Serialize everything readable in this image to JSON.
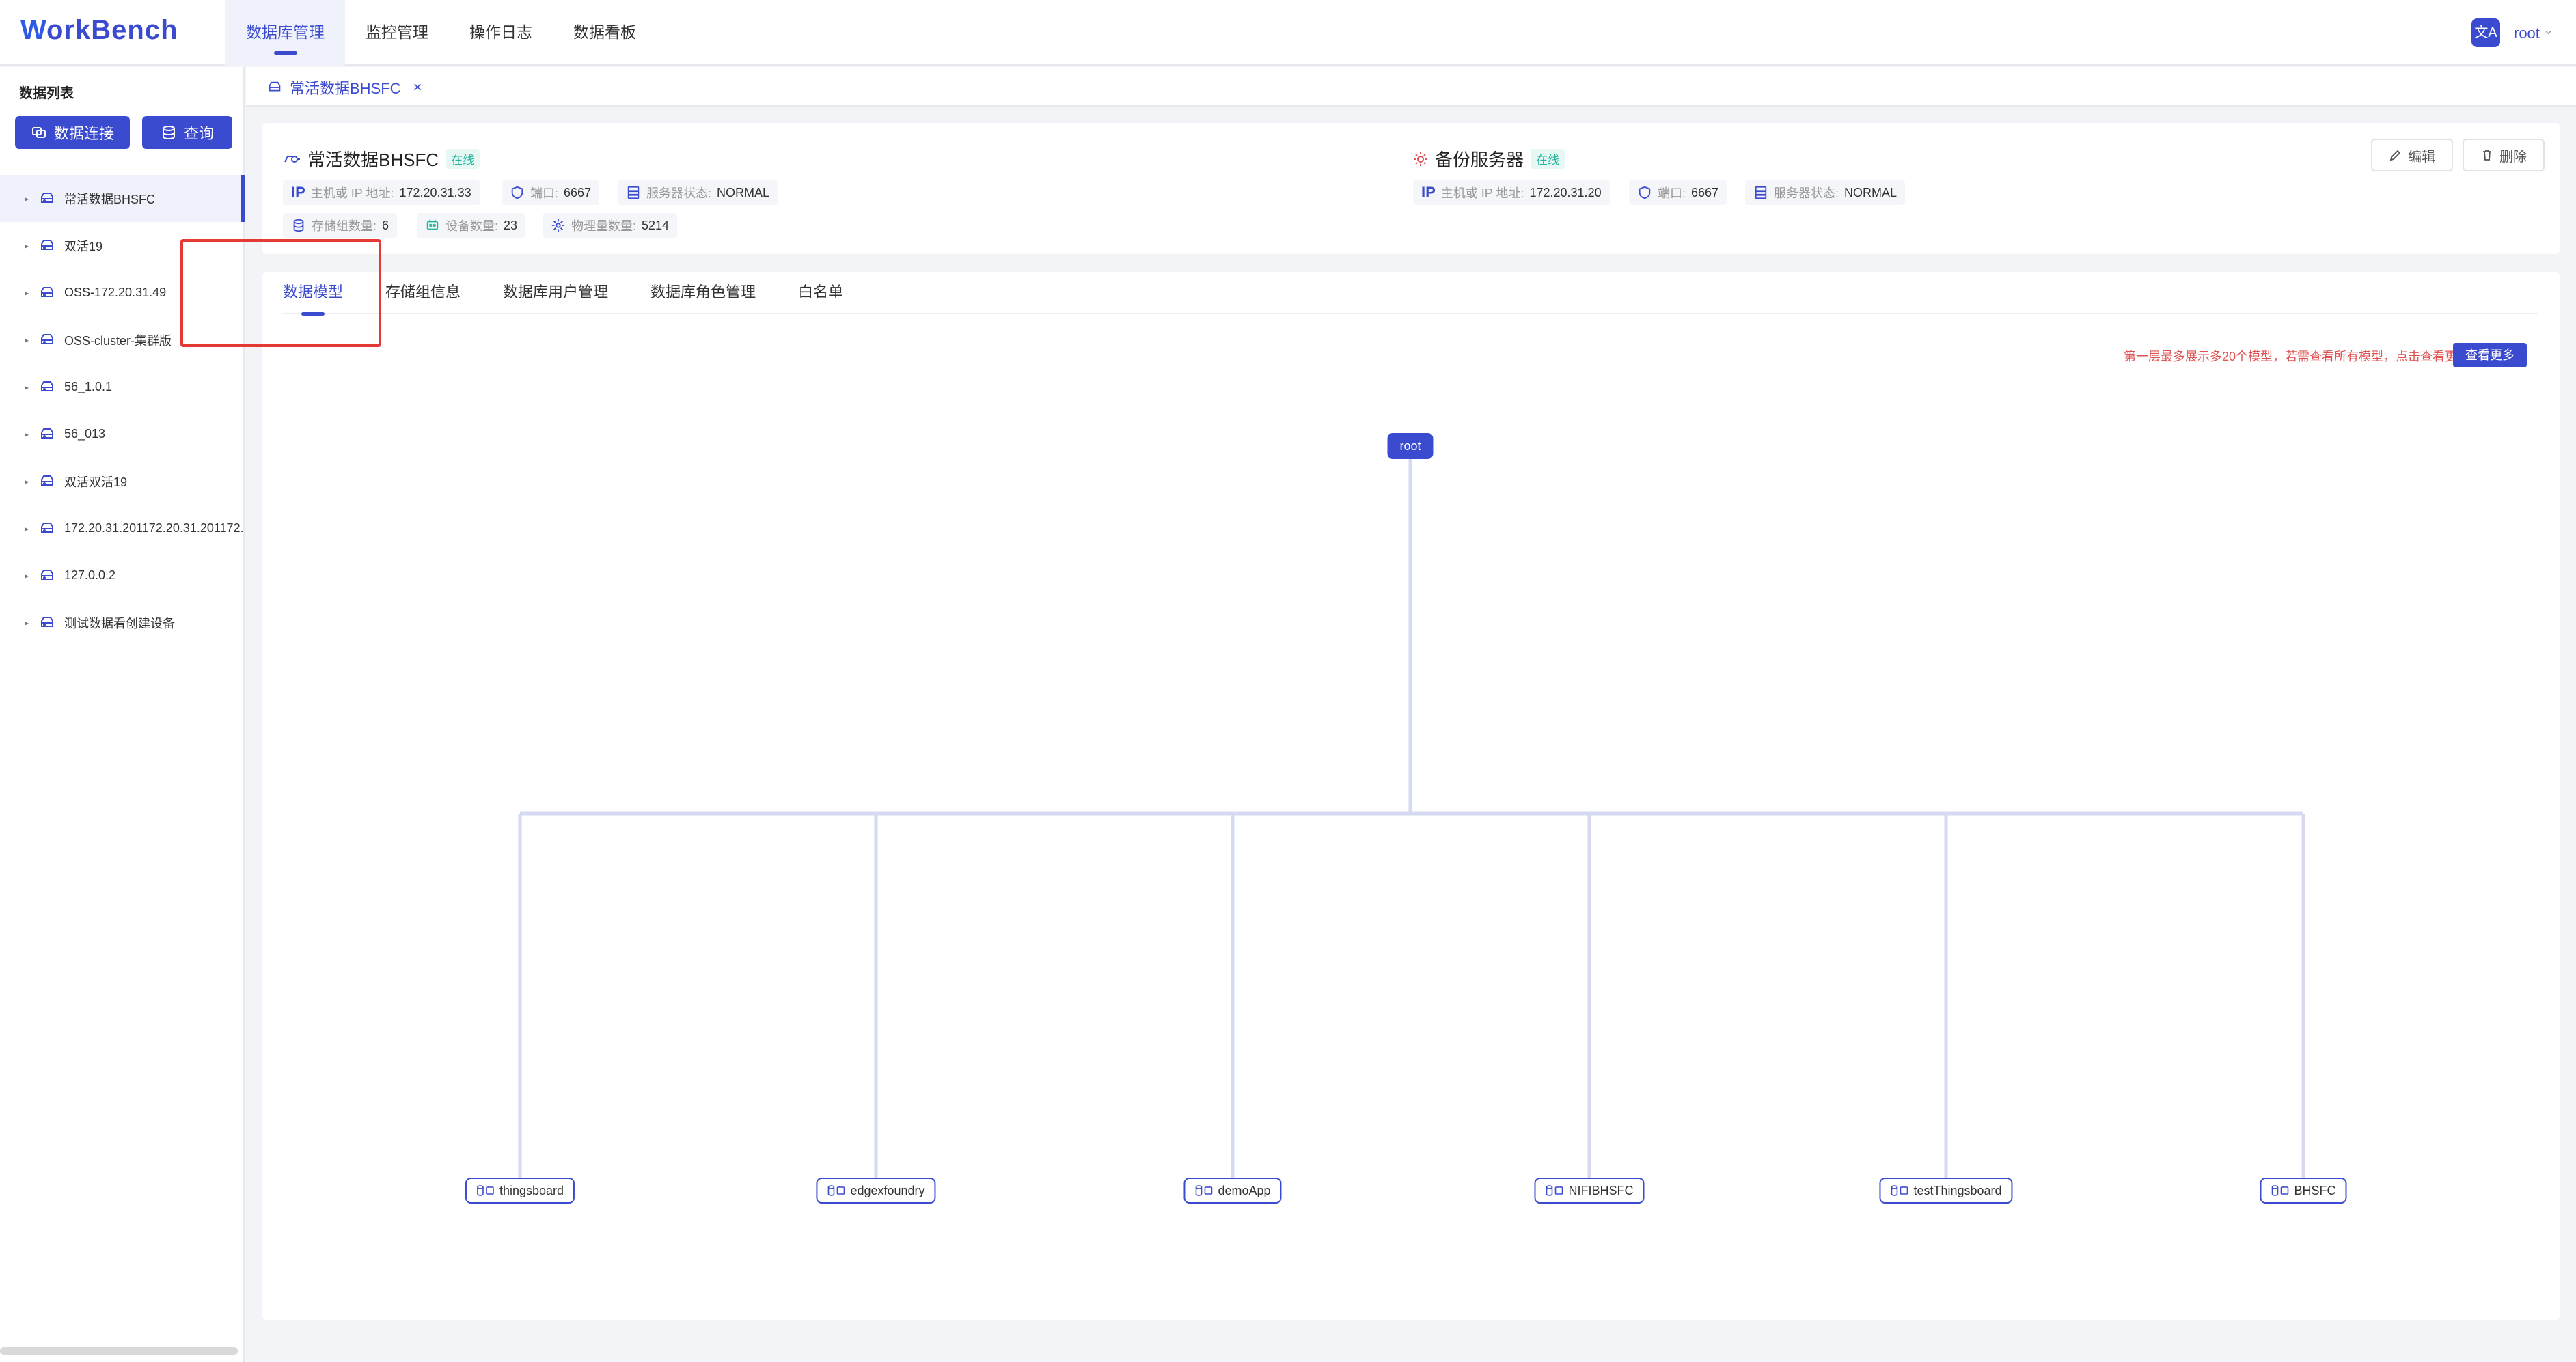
{
  "app": {
    "logo_w": "W",
    "logo_rest": "orkBench"
  },
  "nav": [
    {
      "label": "数据库管理",
      "active": true
    },
    {
      "label": "监控管理",
      "active": false
    },
    {
      "label": "操作日志",
      "active": false
    },
    {
      "label": "数据看板",
      "active": false
    }
  ],
  "user": {
    "translate_glyph": "文A",
    "name": "root",
    "caret": "⌄"
  },
  "sidebar": {
    "title": "数据列表",
    "connect_label": "数据连接",
    "query_label": "查询",
    "items": [
      "常活数据BHSFC",
      "双活19",
      "OSS-172.20.31.49",
      "OSS-cluster-集群版",
      "56_1.0.1",
      "56_013",
      "双活双活19",
      "172.20.31.201172.20.31.201172.",
      "127.0.0.2",
      "测试数据看创建设备"
    ]
  },
  "page_tab": {
    "label": "常活数据BHSFC",
    "close": "×"
  },
  "primary_server": {
    "name": "常活数据BHSFC",
    "status": "在线",
    "ip_tag": "IP",
    "ip_key": "主机或 IP 地址:",
    "ip_value": "172.20.31.33",
    "port_key": "端口:",
    "port_value": "6667",
    "service_key": "服务器状态:",
    "service_value": "NORMAL",
    "sg_key": "存储组数量:",
    "sg_value": "6",
    "device_key": "设备数量:",
    "device_value": "23",
    "measure_key": "物理量数量:",
    "measure_value": "5214"
  },
  "backup_server": {
    "name": "备份服务器",
    "status": "在线",
    "ip_tag": "IP",
    "ip_key": "主机或 IP 地址:",
    "ip_value": "172.20.31.20",
    "port_key": "端口:",
    "port_value": "6667",
    "service_key": "服务器状态:",
    "service_value": "NORMAL"
  },
  "actions": {
    "edit": "编辑",
    "delete": "删除"
  },
  "tabs": [
    "数据模型",
    "存储组信息",
    "数据库用户管理",
    "数据库角色管理",
    "白名单"
  ],
  "model": {
    "notice": "第一层最多展示多20个模型，若需查看所有模型，点击查看更多",
    "view_more": "查看更多",
    "root": "root",
    "children": [
      "thingsboard",
      "edgexfoundry",
      "demoApp",
      "NIFIBHSFC",
      "testThingsboard",
      "BHSFC"
    ]
  },
  "colors": {
    "accent": "#3b4bcf",
    "online": "#1fb59b",
    "notice": "#e05252",
    "highlight": "#e53935"
  }
}
